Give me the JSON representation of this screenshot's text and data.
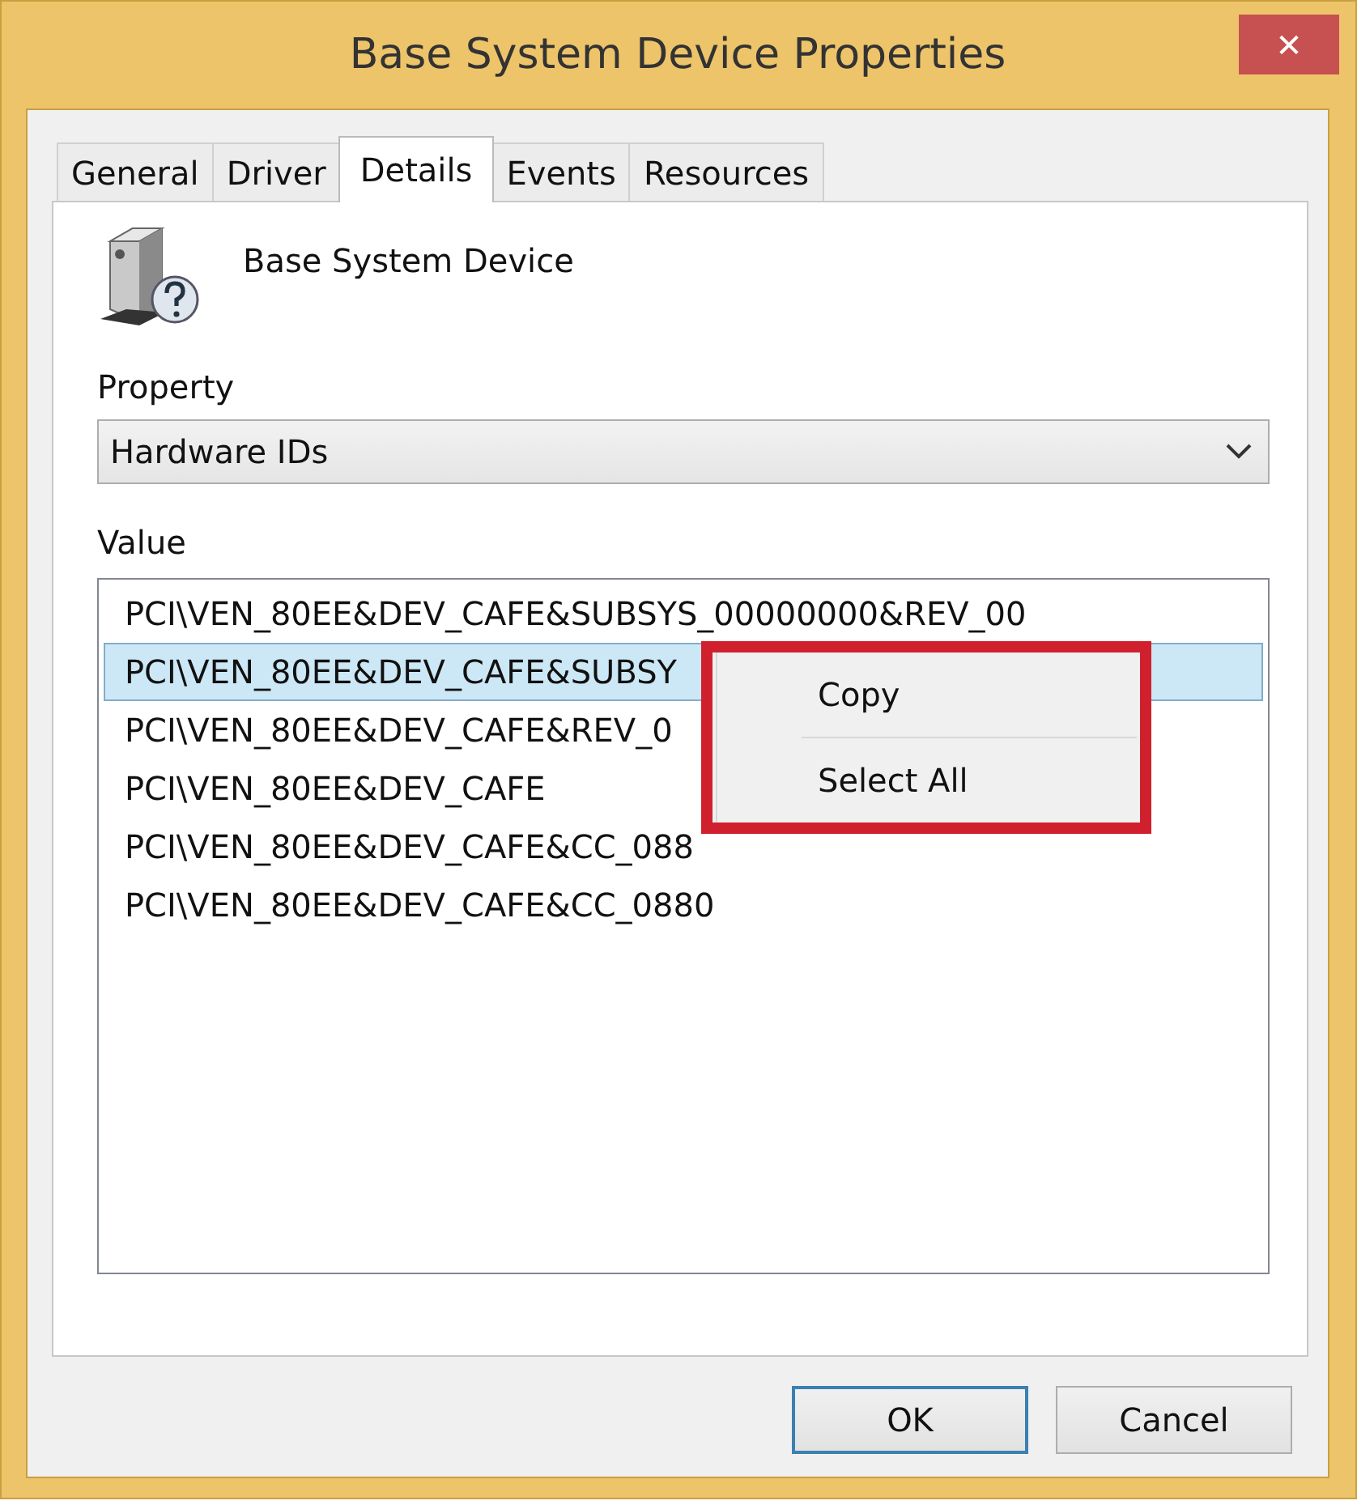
{
  "window": {
    "title": "Base System Device Properties",
    "close": "✕"
  },
  "tabs": [
    {
      "label": "General",
      "selected": false
    },
    {
      "label": "Driver",
      "selected": false
    },
    {
      "label": "Details",
      "selected": true
    },
    {
      "label": "Events",
      "selected": false
    },
    {
      "label": "Resources",
      "selected": false
    }
  ],
  "device": {
    "name": "Base System Device"
  },
  "property": {
    "label": "Property",
    "value": "Hardware IDs"
  },
  "value": {
    "label": "Value",
    "rows": [
      {
        "text": "PCI\\VEN_80EE&DEV_CAFE&SUBSYS_00000000&REV_00",
        "selected": false
      },
      {
        "text": "PCI\\VEN_80EE&DEV_CAFE&SUBSY",
        "selected": true
      },
      {
        "text": "PCI\\VEN_80EE&DEV_CAFE&REV_0",
        "selected": false
      },
      {
        "text": "PCI\\VEN_80EE&DEV_CAFE",
        "selected": false
      },
      {
        "text": "PCI\\VEN_80EE&DEV_CAFE&CC_088",
        "selected": false
      },
      {
        "text": "PCI\\VEN_80EE&DEV_CAFE&CC_0880",
        "selected": false
      }
    ]
  },
  "context_menu": {
    "highlighted": true,
    "items": [
      "Copy",
      "Select All"
    ]
  },
  "buttons": [
    {
      "label": "OK",
      "default": true
    },
    {
      "label": "Cancel",
      "default": false
    }
  ]
}
